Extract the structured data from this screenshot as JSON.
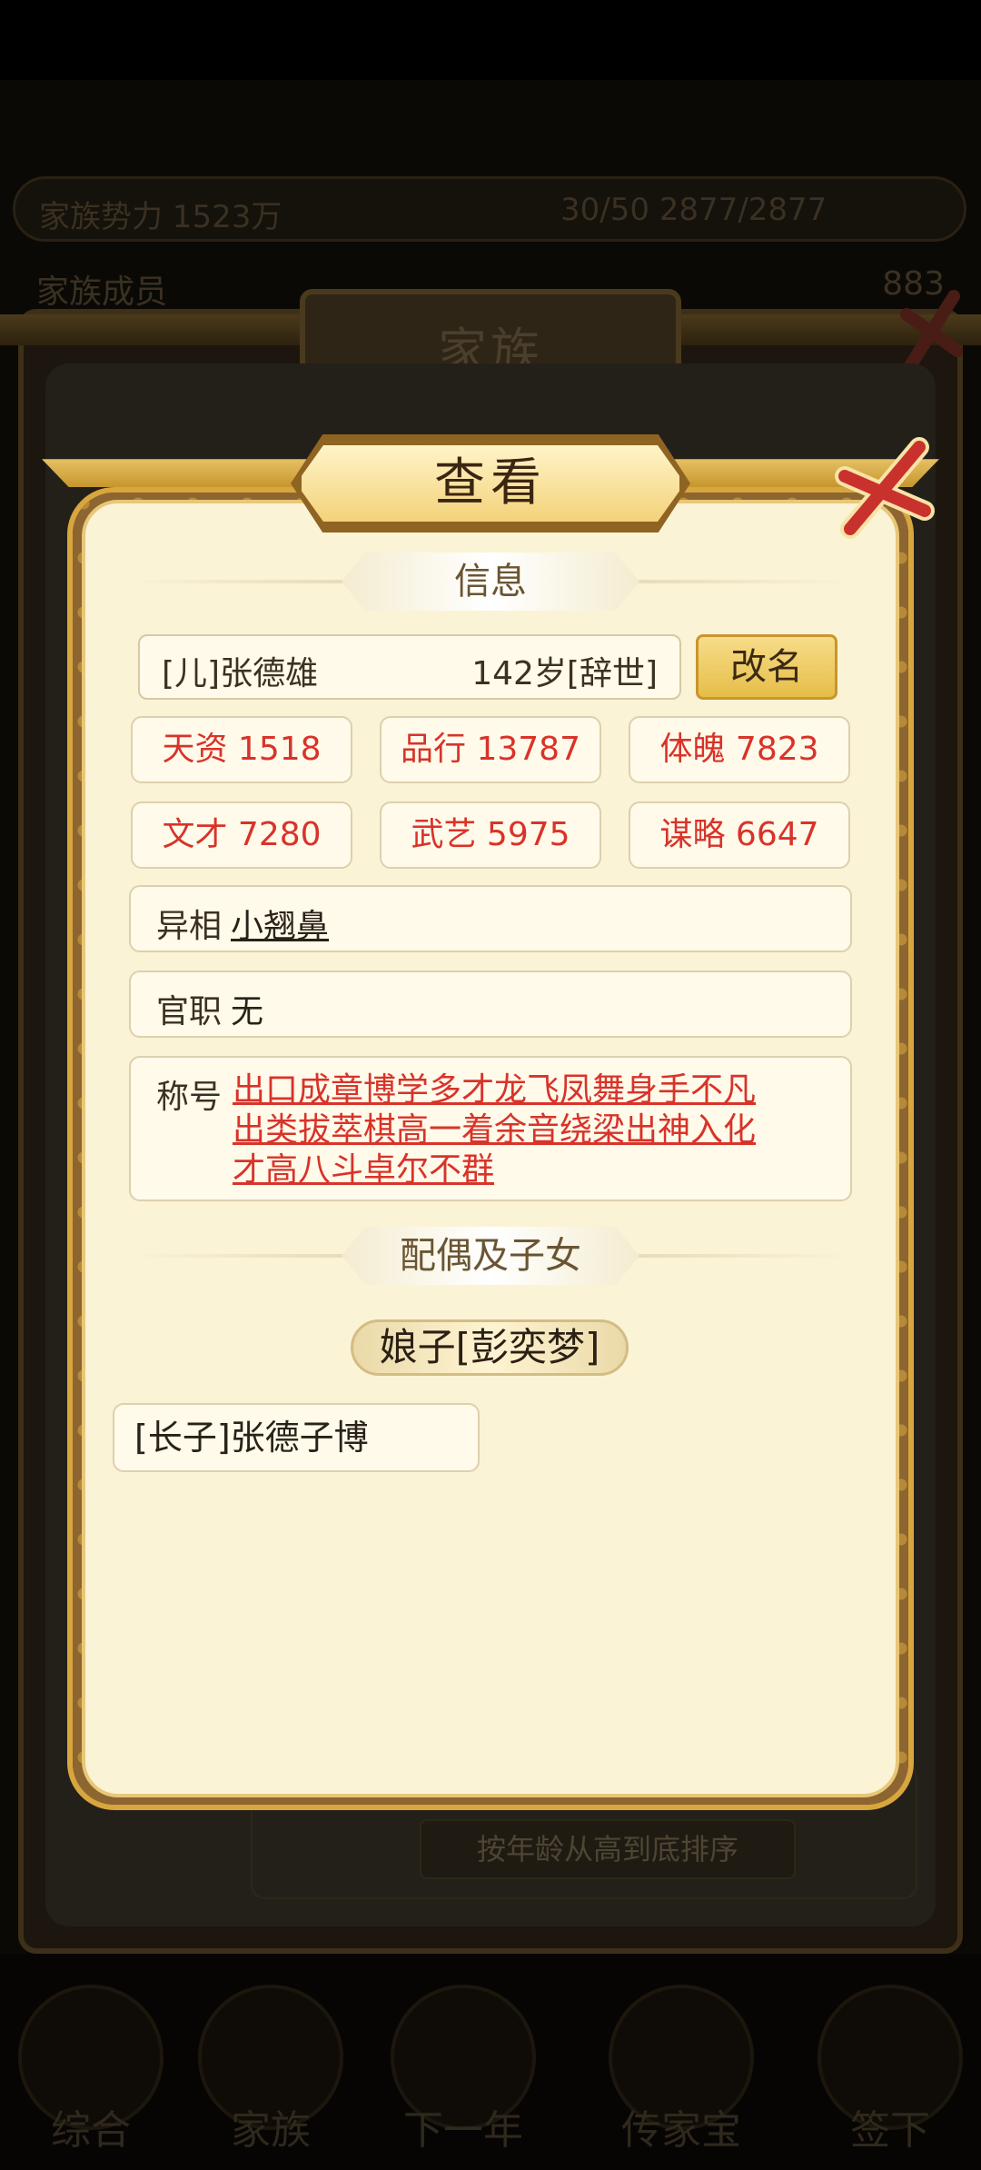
{
  "background": {
    "stats_left": "家族势力 1523万",
    "stats_right": "30/50  2877/2877",
    "family_label": "家族成员",
    "family_count": "883",
    "window_title": "家族",
    "sort_label": "按年龄从高到底排序",
    "nav": [
      "综合",
      "家族",
      "下一年",
      "传家宝",
      "签下"
    ]
  },
  "dialog": {
    "title": "查看",
    "info_header": "信息",
    "name": "[儿]张德雄",
    "age": "142岁[辞世]",
    "rename_button": "改名",
    "attributes": [
      "天资 1518",
      "品行 13787",
      "体魄 7823",
      "文才 7280",
      "武艺 5975",
      "谋略 6647"
    ],
    "appearance_label": "异相",
    "appearance_value": "小翘鼻",
    "official_label": "官职",
    "official_value": "无",
    "titles_label": "称号",
    "titles_lines": [
      "出口成章博学多才龙飞凤舞身手不凡",
      "出类拔萃棋高一着余音绕梁出神入化",
      "才高八斗卓尔不群"
    ],
    "family_header": "配偶及子女",
    "spouse": "娘子[彭奕梦]",
    "children": [
      "[长子]张德子博"
    ]
  },
  "colors": {
    "attribute_text": "#d8332a",
    "panel_bg": "#fbf3d6",
    "gold": "#e6bd48"
  }
}
